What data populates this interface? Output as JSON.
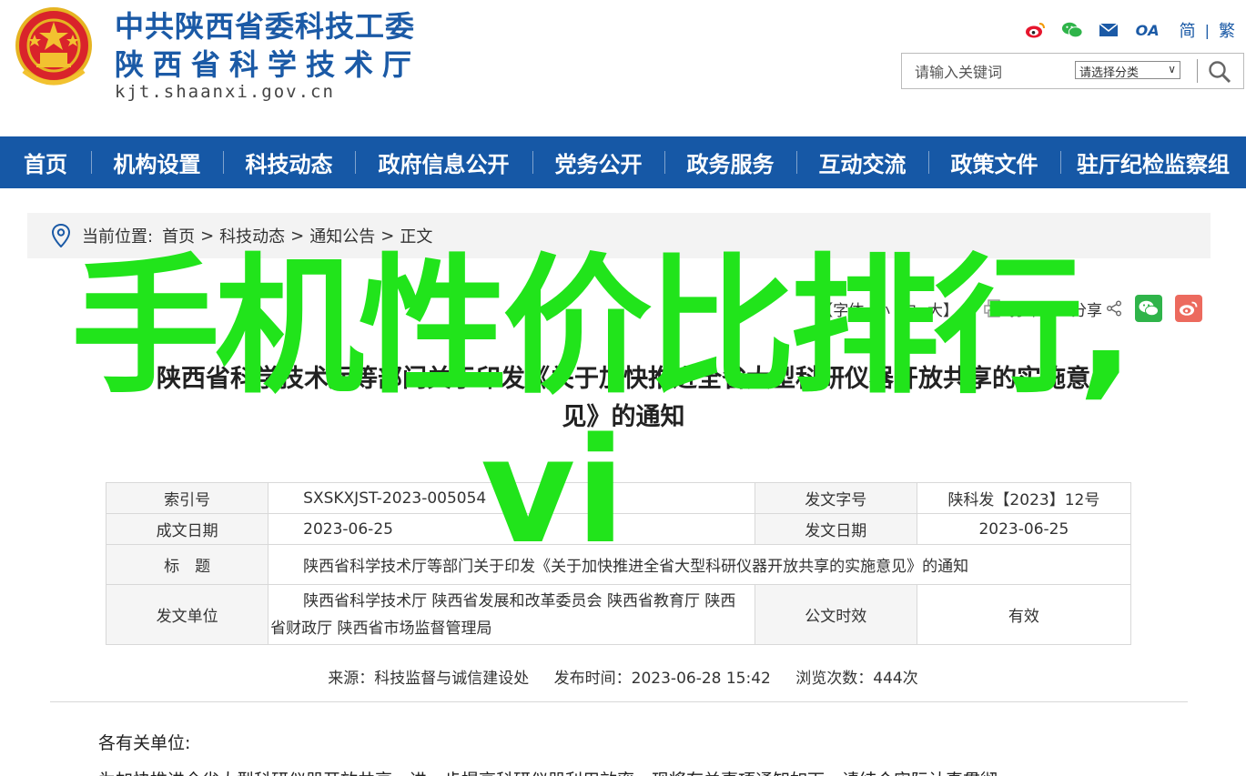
{
  "header": {
    "org_line1": "中共陕西省委科技工委",
    "org_line2": "陕西省科学技术厅",
    "domain": "kjt.shaanxi.gov.cn",
    "lang_simplified": "简",
    "lang_sep": "|",
    "lang_traditional": "繁",
    "oa_label": "OA",
    "search": {
      "placeholder": "请输入关键词",
      "category_label": "请选择分类"
    }
  },
  "nav": {
    "items": [
      "首页",
      "机构设置",
      "科技动态",
      "政府信息公开",
      "党务公开",
      "政务服务",
      "互动交流",
      "政策文件",
      "驻厅纪检监察组"
    ]
  },
  "breadcrumb": {
    "label": "当前位置:",
    "items": [
      "首页",
      "科技动态",
      "通知公告",
      "正文"
    ],
    "sep": ">"
  },
  "article_tools": {
    "font_label": "【字体:",
    "font_small": "小",
    "font_medium": "中",
    "font_large": "大】",
    "print": "打印",
    "share": "分享"
  },
  "article": {
    "title_line1": "陕西省科学技术厅等部门关于印发《关于加快推进全省大型科研仪器开放共享的实施意",
    "title_line2": "见》的通知",
    "info": {
      "index_key": "索引号",
      "index_value": "SXSKXJST-2023-005054",
      "doc_no_key": "发文字号",
      "doc_no_value": "陕科发【2023】12号",
      "written_key": "成文日期",
      "written_value": "2023-06-25",
      "issue_date_key": "发文日期",
      "issue_date_value": "2023-06-25",
      "subject_key": "标　题",
      "subject_value": "陕西省科学技术厅等部门关于印发《关于加快推进全省大型科研仪器开放共享的实施意见》的通知",
      "issuer_key": "发文单位",
      "issuer_value": "陕西省科学技术厅 陕西省发展和改革委员会 陕西省教育厅 陕西省财政厅 陕西省市场监督管理局",
      "validity_key": "公文时效",
      "validity_value": "有效"
    },
    "meta": {
      "source": "来源：科技监督与诚信建设处",
      "published": "发布时间：2023-06-28 15:42",
      "views": "浏览次数：444次"
    },
    "salutation": "各有关单位:",
    "first_line": "为加快推进全省大型科研仪器开放共享，进一步提高科研仪器利用效率，现将有关事项通知如下，请结合实际认真贯彻"
  },
  "overlay": {
    "line1": "手机性价比排行,",
    "line2": "vi"
  },
  "colors": {
    "brand_blue": "#1658a6",
    "title_blue": "#1b5aa6",
    "overlay_green": "#21e41b",
    "wechat_green": "#2fb44a",
    "weibo_red": "#ec6a5e"
  },
  "icons": [
    "national-emblem-icon",
    "weibo-icon",
    "wechat-icon",
    "mail-icon",
    "search-icon",
    "location-pin-icon",
    "print-icon",
    "share-icon"
  ]
}
